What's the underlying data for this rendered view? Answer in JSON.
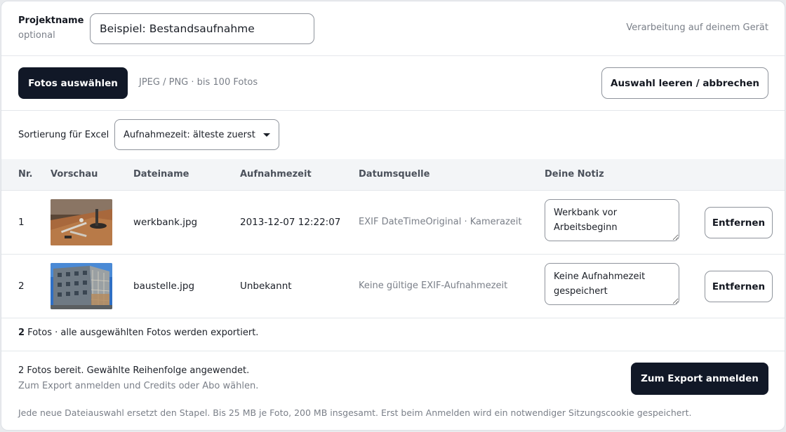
{
  "project": {
    "label": "Projektname",
    "optional": "optional",
    "input_value": "Beispiel: Bestandsaufnahme",
    "processing_note": "Verarbeitung auf deinem Gerät"
  },
  "select": {
    "button_label": "Fotos auswählen",
    "hint": "JPEG / PNG · bis 100 Fotos",
    "clear_label": "Auswahl leeren / abbrechen"
  },
  "sort": {
    "label": "Sortierung für Excel",
    "selected": "Aufnahmezeit: älteste zuerst"
  },
  "table": {
    "headers": [
      "Nr.",
      "Vorschau",
      "Dateiname",
      "Aufnahmezeit",
      "Datumsquelle",
      "Deine Notiz"
    ],
    "rows": [
      {
        "nr": "1",
        "filename": "werkbank.jpg",
        "time": "2013-12-07 12:22:07",
        "source": "EXIF DateTimeOriginal · Kamerazeit",
        "note": "Werkbank vor Arbeitsbeginn",
        "remove_label": "Entfernen"
      },
      {
        "nr": "2",
        "filename": "baustelle.jpg",
        "time": "Unbekannt",
        "source": "Keine gültige EXIF-Aufnahmezeit",
        "note": "Keine Aufnahmezeit gespeichert",
        "remove_label": "Entfernen"
      }
    ]
  },
  "summary": {
    "count": "2",
    "text": " Fotos · alle ausgewählten Fotos werden exportiert."
  },
  "footer": {
    "ready_main": "2 Fotos bereit. Gewählte Reihenfolge angewendet.",
    "ready_sub": "Zum Export anmelden und Credits oder Abo wählen.",
    "export_label": "Zum Export anmelden",
    "fineprint": "Jede neue Dateiauswahl ersetzt den Stapel. Bis 25 MB je Foto, 200 MB insgesamt. Erst beim Anmelden wird ein notwendiger Sitzungscookie gespeichert."
  },
  "colors": {
    "primary_button": "#111827",
    "border": "#8f949c",
    "muted_text": "#7a7f88",
    "table_header_bg": "#f3f5f7"
  }
}
